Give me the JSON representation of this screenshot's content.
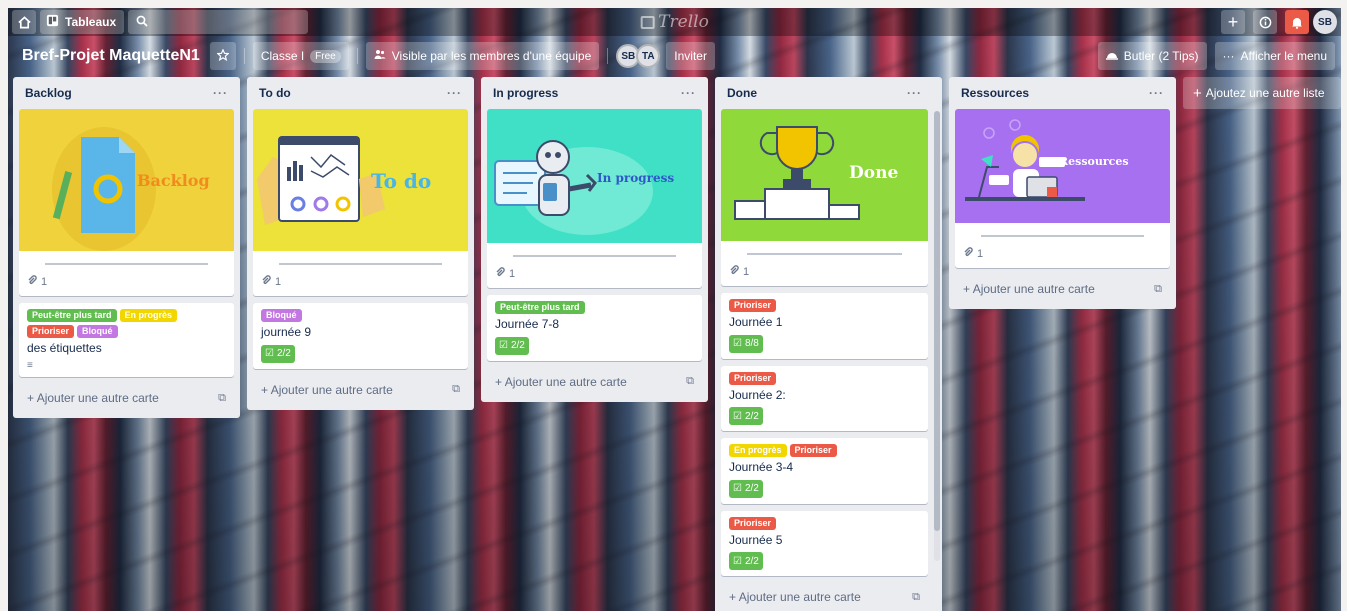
{
  "topbar": {
    "home_icon": "home-icon",
    "boards_label": "Tableaux",
    "search_icon": "search-icon",
    "logo_text": "Trello",
    "create_icon": "plus-icon",
    "info_icon": "info-icon",
    "notification_icon": "bell-icon",
    "user_initials": "SB"
  },
  "board": {
    "title": "Bref-Projet MaquetteN1",
    "star_icon": "star-icon",
    "team_label": "Classe I",
    "plan_badge": "Free",
    "visibility_label": "Visible par les membres d'une équipe",
    "members": [
      "SB",
      "TA"
    ],
    "invite_label": "Inviter",
    "butler_label": "Butler (2 Tips)",
    "menu_label": "Afficher le menu",
    "add_list_label": "Ajoutez une autre liste"
  },
  "lists": [
    {
      "title": "Backlog",
      "cover_card": {
        "cover_text": "Backlog",
        "attachments": "1",
        "cover_color": "#f0d33c"
      },
      "cards": [
        {
          "labels": [
            {
              "text": "Peut-être plus tard",
              "color": "green"
            },
            {
              "text": "En progrès",
              "color": "yellow"
            },
            {
              "text": "Prioriser",
              "color": "red"
            },
            {
              "text": "Bloqué",
              "color": "purple"
            }
          ],
          "title": "des étiquettes",
          "has_description": true
        }
      ],
      "add_card_label": "Ajouter une autre carte"
    },
    {
      "title": "To do",
      "cover_card": {
        "cover_text": "To do",
        "attachments": "1",
        "cover_color": "#ece23a"
      },
      "cards": [
        {
          "labels": [
            {
              "text": "Bloqué",
              "color": "purple"
            }
          ],
          "title": "journée 9",
          "checklist": "2/2"
        }
      ],
      "add_card_label": "Ajouter une autre carte"
    },
    {
      "title": "In progress",
      "cover_card": {
        "cover_text": "In progress",
        "attachments": "1",
        "cover_color": "#3fe0c6"
      },
      "cards": [
        {
          "labels": [
            {
              "text": "Peut-être plus tard",
              "color": "green"
            }
          ],
          "title": "Journée 7-8",
          "checklist": "2/2"
        }
      ],
      "add_card_label": "Ajouter une autre carte"
    },
    {
      "title": "Done",
      "cover_card": {
        "cover_text": "Done",
        "attachments": "1",
        "cover_color": "#8fd93a"
      },
      "cards": [
        {
          "labels": [
            {
              "text": "Prioriser",
              "color": "red"
            }
          ],
          "title": "Journée 1",
          "checklist": "8/8"
        },
        {
          "labels": [
            {
              "text": "Prioriser",
              "color": "red"
            }
          ],
          "title": "Journée 2:",
          "checklist": "2/2"
        },
        {
          "labels": [
            {
              "text": "En progrès",
              "color": "yellow"
            },
            {
              "text": "Prioriser",
              "color": "red"
            }
          ],
          "title": "Journée 3-4",
          "checklist": "2/2"
        },
        {
          "labels": [
            {
              "text": "Prioriser",
              "color": "red"
            }
          ],
          "title": "Journée 5",
          "checklist": "2/2"
        }
      ],
      "add_card_label": "Ajouter une autre carte"
    },
    {
      "title": "Ressources",
      "cover_card": {
        "cover_text": "Ressources",
        "attachments": "1",
        "cover_color": "#a770f0"
      },
      "cards": [],
      "add_card_label": "Ajouter une autre carte"
    }
  ],
  "icons": {
    "list_menu": "ellipsis-icon",
    "attachment": "paperclip-icon",
    "checklist": "checkbox-icon",
    "description": "description-icon",
    "template": "card-template-icon"
  }
}
